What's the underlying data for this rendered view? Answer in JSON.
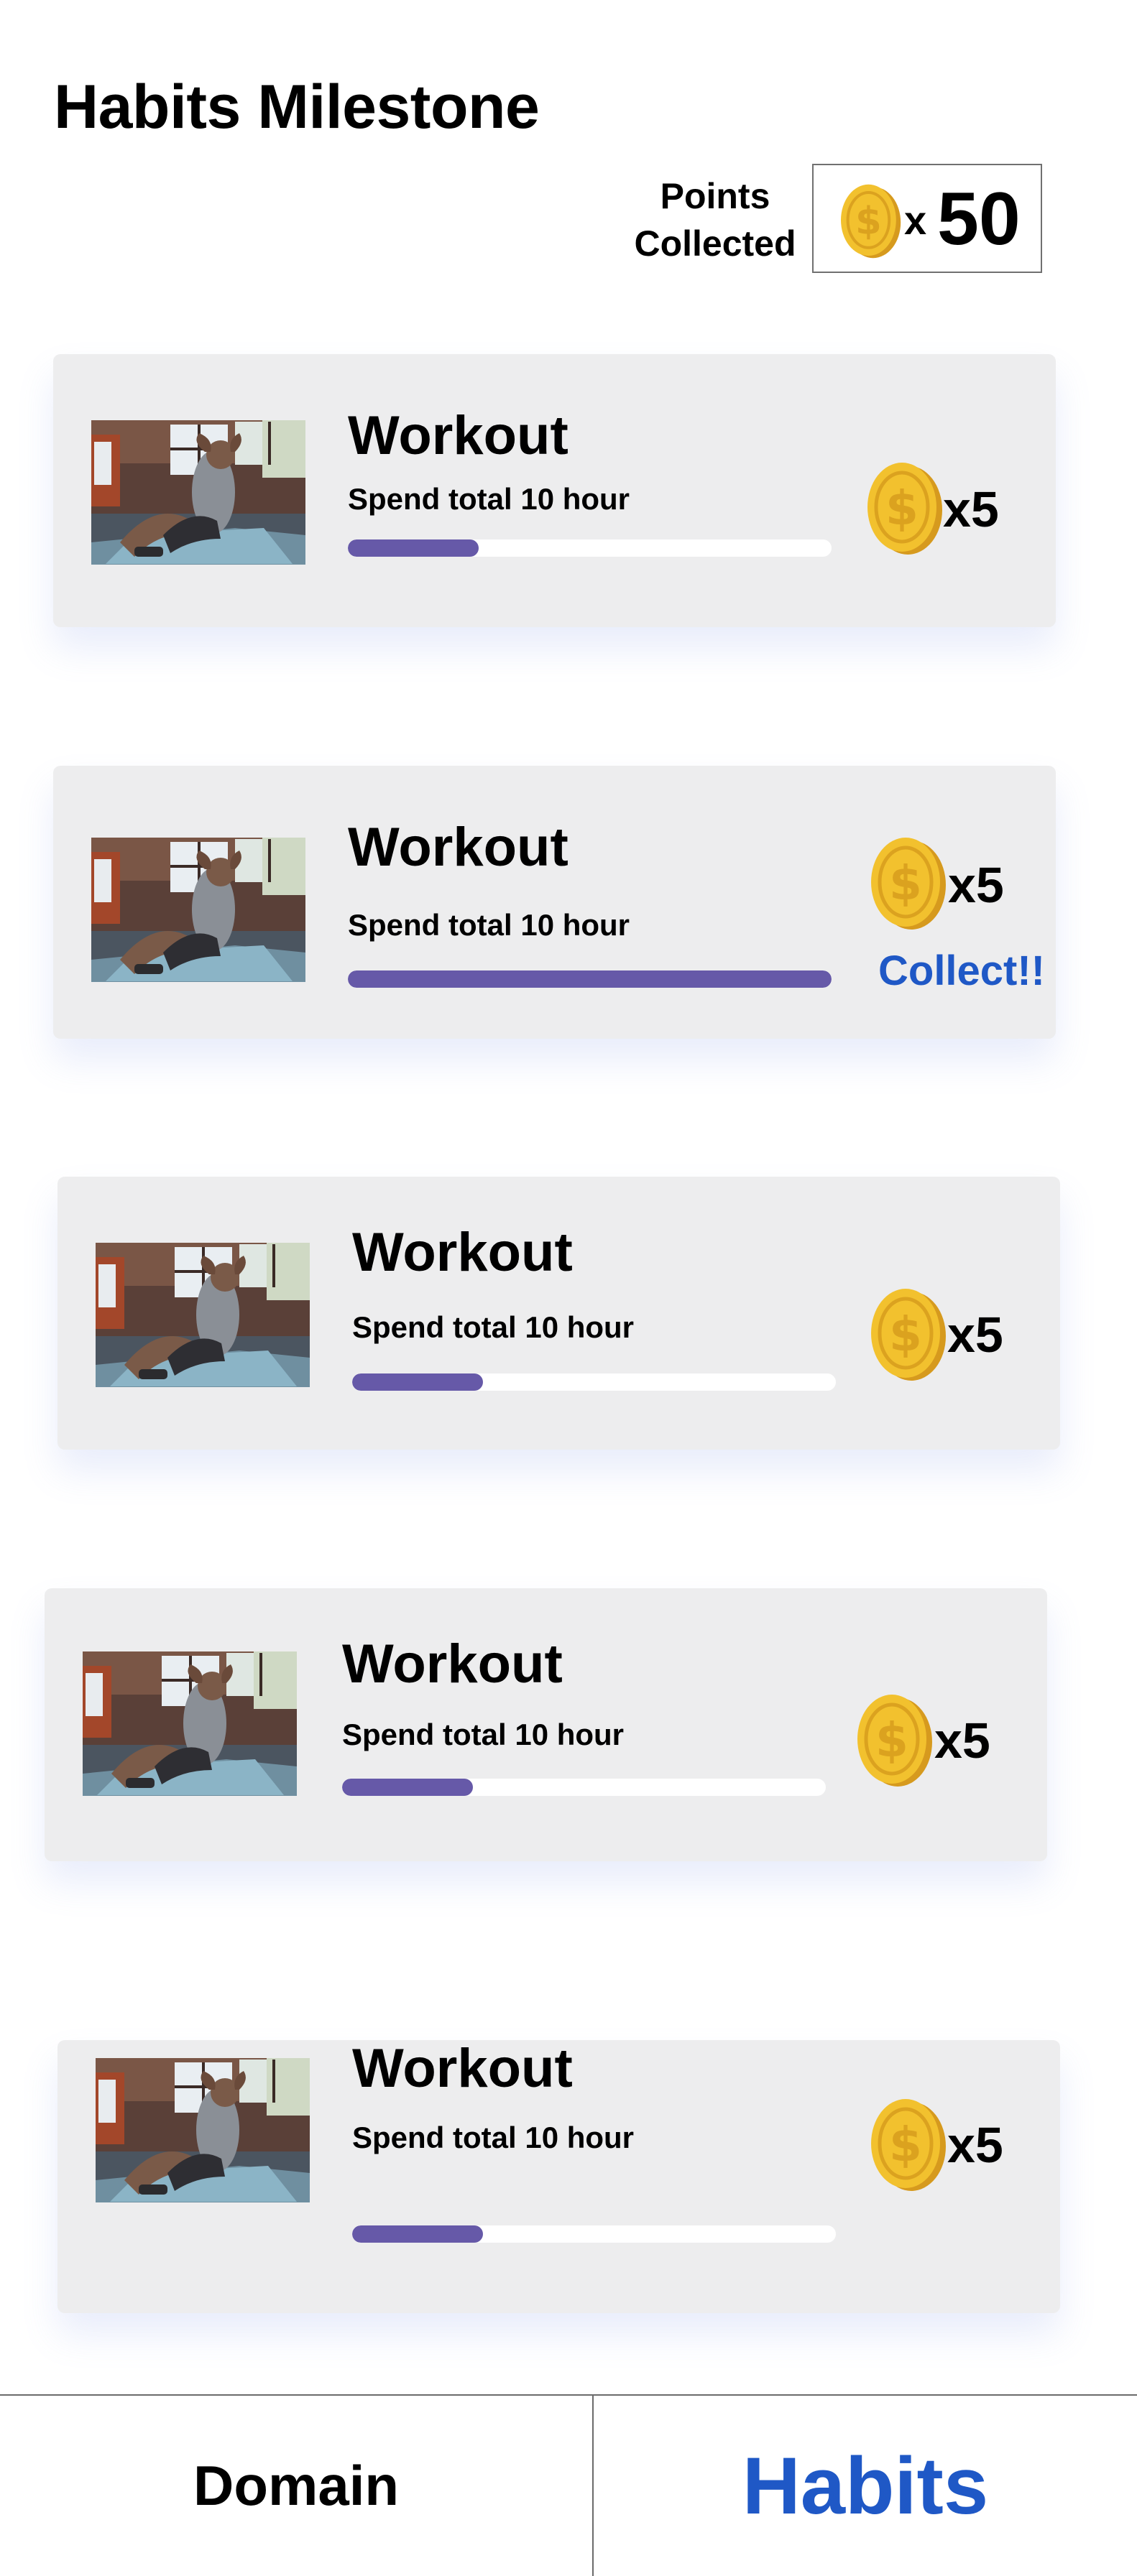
{
  "page": {
    "title": "Habits Milestone"
  },
  "points": {
    "label_line1": "Points",
    "label_line2": "Collected",
    "multiplier_symbol": "x",
    "value": "50",
    "coin_icon": "coin-icon"
  },
  "colors": {
    "progress_fill": "#6659a8",
    "progress_track": "#ffffff",
    "card_bg": "#ededee",
    "accent_blue": "#1f58c6",
    "coin_gold": "#f2c12e"
  },
  "cards": [
    {
      "title": "Workout",
      "subtitle": "Spend total 10 hour",
      "reward": "x5",
      "progress": 0.27,
      "image": "workout-thumbnail"
    },
    {
      "title": "Workout",
      "subtitle": "Spend total 10 hour",
      "reward": "x5",
      "progress": 1.0,
      "collect_label": "Collect!!",
      "image": "workout-thumbnail"
    },
    {
      "title": "Workout",
      "subtitle": "Spend total 10 hour",
      "reward": "x5",
      "progress": 0.27,
      "image": "workout-thumbnail"
    },
    {
      "title": "Workout",
      "subtitle": "Spend total 10 hour",
      "reward": "x5",
      "progress": 0.27,
      "image": "workout-thumbnail"
    },
    {
      "title": "Workout",
      "subtitle": "Spend total 10 hour",
      "reward": "x5",
      "progress": 0.27,
      "image": "workout-thumbnail"
    }
  ],
  "nav": {
    "tabs": [
      {
        "label": "Domain",
        "active": false
      },
      {
        "label": "Habits",
        "active": true
      }
    ]
  }
}
